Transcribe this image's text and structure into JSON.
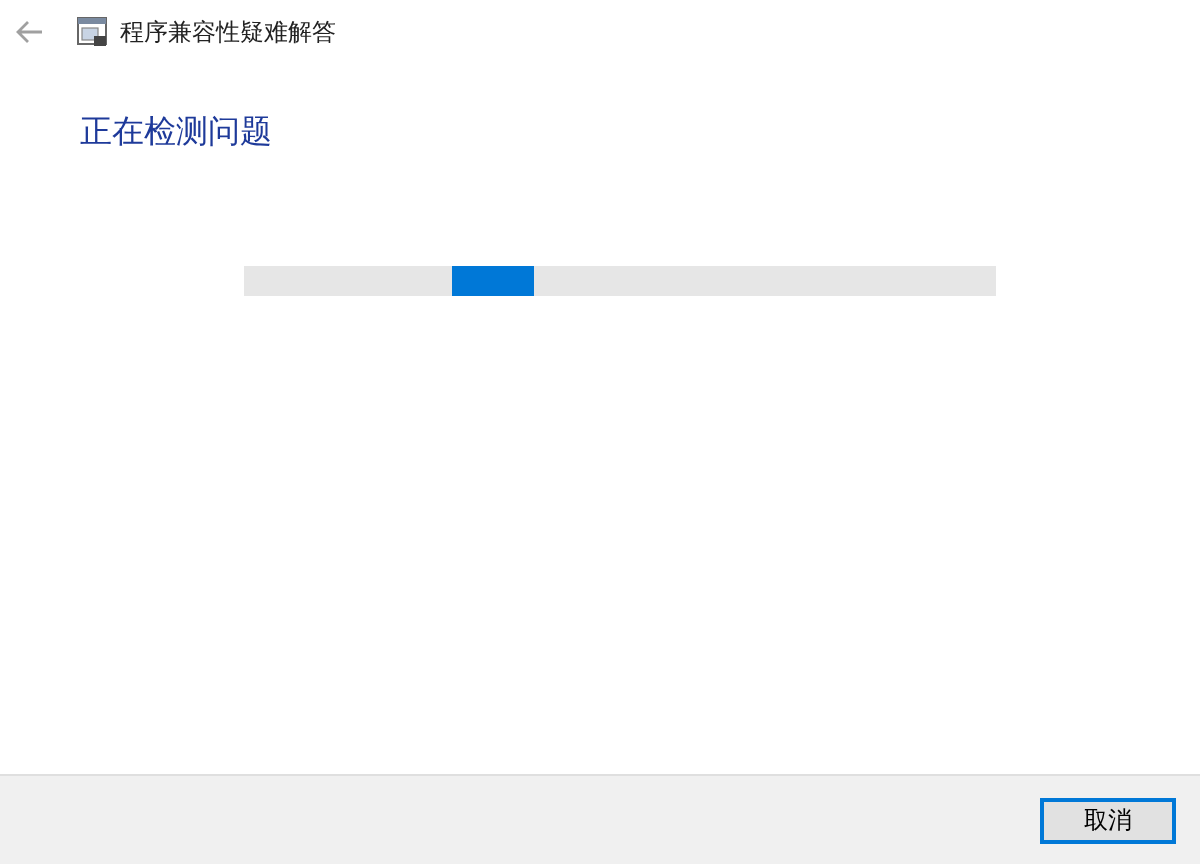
{
  "window": {
    "title": "程序兼容性疑难解答"
  },
  "heading": "正在检测问题",
  "progress": {
    "kind": "marquee"
  },
  "buttons": [
    {
      "label": "取消",
      "focused": true
    }
  ]
}
